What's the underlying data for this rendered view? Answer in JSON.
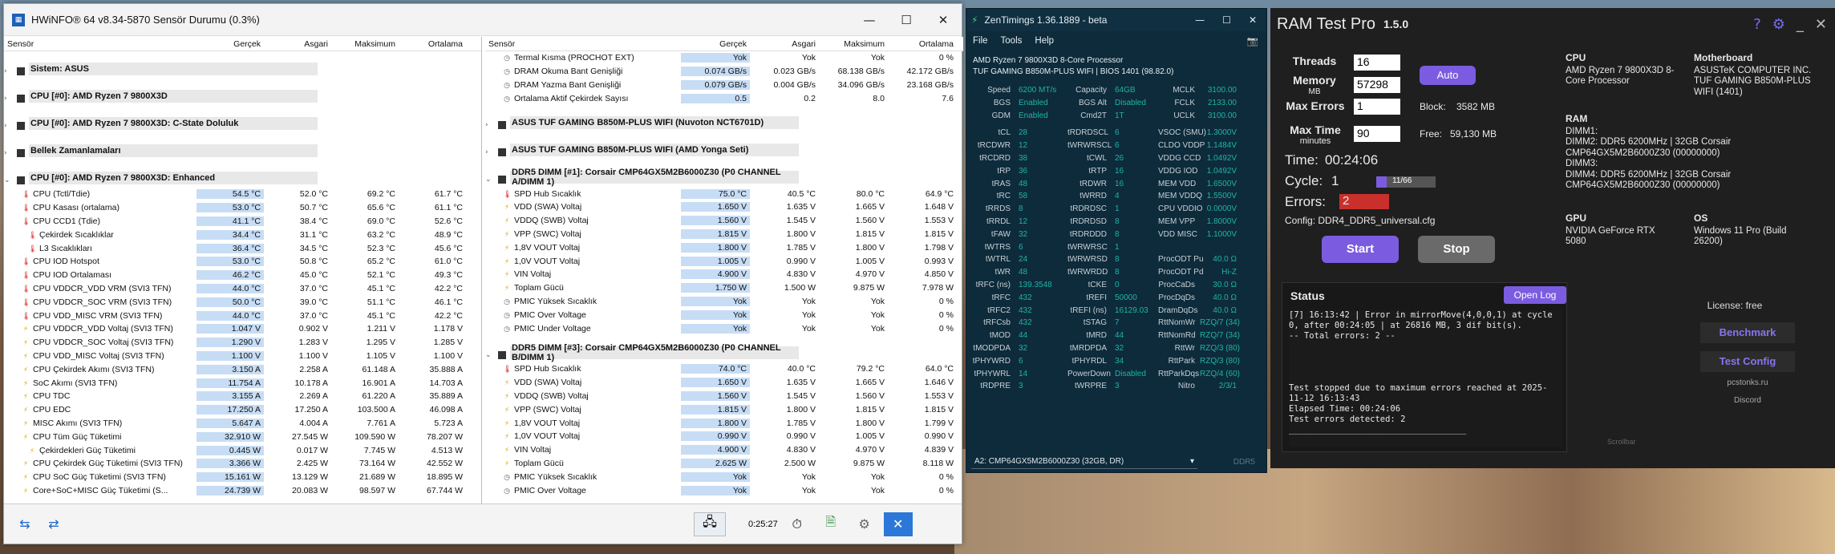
{
  "hw": {
    "title": "HWiNFO® 64 v8.34-5870 Sensör Durumu (0.3%)",
    "headers": [
      "Sensör",
      "Gerçek",
      "Asgari",
      "Maksimum",
      "Ortalama"
    ],
    "left": [
      {
        "g": "Sistem: ASUS",
        "open": false
      },
      {
        "g": "CPU [#0]: AMD Ryzen 7 9800X3D",
        "open": false
      },
      {
        "g": "CPU [#0]: AMD Ryzen 7 9800X3D: C-State Doluluk",
        "open": false
      },
      {
        "g": "Bellek Zamanlamaları",
        "open": false
      },
      {
        "g": "CPU [#0]: AMD Ryzen 7 9800X3D: Enhanced",
        "open": true
      },
      {
        "i": "t",
        "n": "CPU (Tctl/Tdie)",
        "v": [
          "54.5 °C",
          "52.0 °C",
          "69.2 °C",
          "61.7 °C"
        ]
      },
      {
        "i": "t",
        "n": "CPU Kasası (ortalama)",
        "v": [
          "53.0 °C",
          "50.7 °C",
          "65.6 °C",
          "61.1 °C"
        ]
      },
      {
        "i": "t",
        "n": "CPU CCD1 (Tdie)",
        "v": [
          "41.1 °C",
          "38.4 °C",
          "69.0 °C",
          "52.6 °C"
        ]
      },
      {
        "i": "t",
        "n": "Çekirdek Sıcaklıklar",
        "v": [
          "34.4 °C",
          "31.1 °C",
          "63.2 °C",
          "48.9 °C"
        ],
        "sub": true
      },
      {
        "i": "t",
        "n": "L3 Sıcaklıkları",
        "v": [
          "36.4 °C",
          "34.5 °C",
          "52.3 °C",
          "45.6 °C"
        ],
        "sub": true
      },
      {
        "i": "t",
        "n": "CPU IOD Hotspot",
        "v": [
          "53.0 °C",
          "50.8 °C",
          "65.2 °C",
          "61.0 °C"
        ]
      },
      {
        "i": "t",
        "n": "CPU IOD Ortalaması",
        "v": [
          "46.2 °C",
          "45.0 °C",
          "52.1 °C",
          "49.3 °C"
        ]
      },
      {
        "i": "t",
        "n": "CPU VDDCR_VDD VRM (SVI3 TFN)",
        "v": [
          "44.0 °C",
          "37.0 °C",
          "45.1 °C",
          "42.2 °C"
        ]
      },
      {
        "i": "t",
        "n": "CPU VDDCR_SOC VRM (SVI3 TFN)",
        "v": [
          "50.0 °C",
          "39.0 °C",
          "51.1 °C",
          "46.1 °C"
        ]
      },
      {
        "i": "t",
        "n": "CPU VDD_MISC VRM (SVI3 TFN)",
        "v": [
          "44.0 °C",
          "37.0 °C",
          "45.1 °C",
          "42.2 °C"
        ]
      },
      {
        "i": "v",
        "n": "CPU VDDCR_VDD Voltaj (SVI3 TFN)",
        "v": [
          "1.047 V",
          "0.902 V",
          "1.211 V",
          "1.178 V"
        ]
      },
      {
        "i": "v",
        "n": "CPU VDDCR_SOC Voltaj (SVI3 TFN)",
        "v": [
          "1.290 V",
          "1.283 V",
          "1.295 V",
          "1.285 V"
        ]
      },
      {
        "i": "v",
        "n": "CPU VDD_MISC Voltaj (SVI3 TFN)",
        "v": [
          "1.100 V",
          "1.100 V",
          "1.105 V",
          "1.100 V"
        ]
      },
      {
        "i": "v",
        "n": "CPU Çekirdek Akımı (SVI3 TFN)",
        "v": [
          "3.150 A",
          "2.258 A",
          "61.148 A",
          "35.888 A"
        ]
      },
      {
        "i": "v",
        "n": "SoC Akımı (SVI3 TFN)",
        "v": [
          "11.754 A",
          "10.178 A",
          "16.901 A",
          "14.703 A"
        ]
      },
      {
        "i": "v",
        "n": "CPU TDC",
        "v": [
          "3.155 A",
          "2.269 A",
          "61.220 A",
          "35.889 A"
        ]
      },
      {
        "i": "v",
        "n": "CPU EDC",
        "v": [
          "17.250 A",
          "17.250 A",
          "103.500 A",
          "46.098 A"
        ]
      },
      {
        "i": "v",
        "n": "MISC Akımı (SVI3 TFN)",
        "v": [
          "5.647 A",
          "4.004 A",
          "7.761 A",
          "5.723 A"
        ]
      },
      {
        "i": "p",
        "n": "CPU Tüm Güç Tüketimi",
        "v": [
          "32.910 W",
          "27.545 W",
          "109.590 W",
          "78.207 W"
        ]
      },
      {
        "i": "p",
        "n": "Çekirdekleri Güç Tüketimi",
        "v": [
          "0.445 W",
          "0.017 W",
          "7.745 W",
          "4.513 W"
        ],
        "sub": true
      },
      {
        "i": "p",
        "n": "CPU Çekirdek Güç Tüketimi (SVI3 TFN)",
        "v": [
          "3.366 W",
          "2.425 W",
          "73.164 W",
          "42.552 W"
        ]
      },
      {
        "i": "p",
        "n": "CPU SoC Güç Tüketimi (SVI3 TFN)",
        "v": [
          "15.161 W",
          "13.129 W",
          "21.689 W",
          "18.895 W"
        ]
      },
      {
        "i": "p",
        "n": "Core+SoC+MISC Güç Tüketimi (S...",
        "v": [
          "24.739 W",
          "20.083 W",
          "98.597 W",
          "67.744 W"
        ]
      }
    ],
    "right": [
      {
        "i": "o",
        "n": "Termal Kısma (PROCHOT EXT)",
        "v": [
          "Yok",
          "Yok",
          "Yok",
          "0 %"
        ]
      },
      {
        "i": "o",
        "n": "DRAM Okuma Bant Genişliği",
        "v": [
          "0.074 GB/s",
          "0.023 GB/s",
          "68.138 GB/s",
          "42.172 GB/s"
        ]
      },
      {
        "i": "o",
        "n": "DRAM Yazma Bant Genişliği",
        "v": [
          "0.079 GB/s",
          "0.004 GB/s",
          "34.096 GB/s",
          "23.168 GB/s"
        ]
      },
      {
        "i": "o",
        "n": "Ortalama Aktif Çekirdek Sayısı",
        "v": [
          "0.5",
          "0.2",
          "8.0",
          "7.6"
        ]
      },
      {
        "g": "ASUS TUF GAMING B850M-PLUS WIFI (Nuvoton NCT6701D)",
        "open": false
      },
      {
        "g": "ASUS TUF GAMING B850M-PLUS WIFI (AMD Yonga Seti)",
        "open": false
      },
      {
        "g": "DDR5 DIMM [#1]: Corsair CMP64GX5M2B6000Z30 (P0 CHANNEL A/DIMM 1)",
        "open": true
      },
      {
        "i": "t",
        "n": "SPD Hub Sıcaklık",
        "v": [
          "75.0 °C",
          "40.5 °C",
          "80.0 °C",
          "64.9 °C"
        ]
      },
      {
        "i": "v",
        "n": "VDD (SWA) Voltaj",
        "v": [
          "1.650 V",
          "1.635 V",
          "1.665 V",
          "1.648 V"
        ]
      },
      {
        "i": "v",
        "n": "VDDQ (SWB) Voltaj",
        "v": [
          "1.560 V",
          "1.545 V",
          "1.560 V",
          "1.553 V"
        ]
      },
      {
        "i": "v",
        "n": "VPP (SWC) Voltaj",
        "v": [
          "1.815 V",
          "1.800 V",
          "1.815 V",
          "1.815 V"
        ]
      },
      {
        "i": "v",
        "n": "1,8V VOUT Voltaj",
        "v": [
          "1.800 V",
          "1.785 V",
          "1.800 V",
          "1.798 V"
        ]
      },
      {
        "i": "v",
        "n": "1,0V VOUT Voltaj",
        "v": [
          "1.005 V",
          "0.990 V",
          "1.005 V",
          "0.993 V"
        ]
      },
      {
        "i": "v",
        "n": "VIN Voltaj",
        "v": [
          "4.900 V",
          "4.830 V",
          "4.970 V",
          "4.850 V"
        ]
      },
      {
        "i": "p",
        "n": "Toplam Gücü",
        "v": [
          "1.750 W",
          "1.500 W",
          "9.875 W",
          "7.978 W"
        ]
      },
      {
        "i": "o",
        "n": "PMIC Yüksek Sıcaklık",
        "v": [
          "Yok",
          "Yok",
          "Yok",
          "0 %"
        ]
      },
      {
        "i": "o",
        "n": "PMIC Over Voltage",
        "v": [
          "Yok",
          "Yok",
          "Yok",
          "0 %"
        ]
      },
      {
        "i": "o",
        "n": "PMIC Under Voltage",
        "v": [
          "Yok",
          "Yok",
          "Yok",
          "0 %"
        ]
      },
      {
        "g": "DDR5 DIMM [#3]: Corsair CMP64GX5M2B6000Z30 (P0 CHANNEL B/DIMM 1)",
        "open": true
      },
      {
        "i": "t",
        "n": "SPD Hub Sıcaklık",
        "v": [
          "74.0 °C",
          "40.0 °C",
          "79.2 °C",
          "64.0 °C"
        ]
      },
      {
        "i": "v",
        "n": "VDD (SWA) Voltaj",
        "v": [
          "1.650 V",
          "1.635 V",
          "1.665 V",
          "1.646 V"
        ]
      },
      {
        "i": "v",
        "n": "VDDQ (SWB) Voltaj",
        "v": [
          "1.560 V",
          "1.545 V",
          "1.560 V",
          "1.553 V"
        ]
      },
      {
        "i": "v",
        "n": "VPP (SWC) Voltaj",
        "v": [
          "1.815 V",
          "1.800 V",
          "1.815 V",
          "1.815 V"
        ]
      },
      {
        "i": "v",
        "n": "1,8V VOUT Voltaj",
        "v": [
          "1.800 V",
          "1.785 V",
          "1.800 V",
          "1.799 V"
        ]
      },
      {
        "i": "v",
        "n": "1,0V VOUT Voltaj",
        "v": [
          "0.990 V",
          "0.990 V",
          "1.005 V",
          "0.990 V"
        ]
      },
      {
        "i": "v",
        "n": "VIN Voltaj",
        "v": [
          "4.900 V",
          "4.830 V",
          "4.970 V",
          "4.839 V"
        ]
      },
      {
        "i": "p",
        "n": "Toplam Gücü",
        "v": [
          "2.625 W",
          "2.500 W",
          "9.875 W",
          "8.118 W"
        ]
      },
      {
        "i": "o",
        "n": "PMIC Yüksek Sıcaklık",
        "v": [
          "Yok",
          "Yok",
          "Yok",
          "0 %"
        ]
      },
      {
        "i": "o",
        "n": "PMIC Over Voltage",
        "v": [
          "Yok",
          "Yok",
          "Yok",
          "0 %"
        ]
      }
    ],
    "timer": "0:25:27"
  },
  "zen": {
    "title": "ZenTimings 1.36.1889 - beta",
    "menu": [
      "File",
      "Tools",
      "Help"
    ],
    "cpu": "AMD Ryzen 7 9800X3D 8-Core Processor",
    "board": "TUF GAMING B850M-PLUS WIFI | BIOS 1401 (98.82.0)",
    "top": [
      [
        "Speed",
        "6200 MT/s",
        "Capacity",
        "64GB",
        "MCLK",
        "3100.00"
      ],
      [
        "BGS",
        "Enabled",
        "BGS Alt",
        "Disabled",
        "FCLK",
        "2133.00"
      ],
      [
        "GDM",
        "Enabled",
        "Cmd2T",
        "1T",
        "UCLK",
        "3100.00"
      ]
    ],
    "rows": [
      [
        "tCL",
        "28",
        "tRDRDSCL",
        "6",
        "VSOC (SMU)",
        "1.3000V"
      ],
      [
        "tRCDWR",
        "12",
        "tWRWRSCL",
        "6",
        "CLDO VDDP",
        "1.1484V"
      ],
      [
        "tRCDRD",
        "38",
        "tCWL",
        "26",
        "VDDG CCD",
        "1.0492V"
      ],
      [
        "tRP",
        "36",
        "tRTP",
        "16",
        "VDDG IOD",
        "1.0492V"
      ],
      [
        "tRAS",
        "48",
        "tRDWR",
        "16",
        "MEM VDD",
        "1.6500V"
      ],
      [
        "tRC",
        "58",
        "tWRRD",
        "4",
        "MEM VDDQ",
        "1.5500V"
      ],
      [
        "tRRDS",
        "8",
        "tRDRDSC",
        "1",
        "CPU VDDIO",
        "0.0000V"
      ],
      [
        "tRRDL",
        "12",
        "tRDRDSD",
        "8",
        "MEM VPP",
        "1.8000V"
      ],
      [
        "tFAW",
        "32",
        "tRDRDDD",
        "8",
        "VDD MISC",
        "1.1000V"
      ],
      [
        "tWTRS",
        "6",
        "tWRWRSC",
        "1",
        "",
        ""
      ],
      [
        "tWTRL",
        "24",
        "tWRWRSD",
        "8",
        "ProcODT Pu",
        "40.0 Ω"
      ],
      [
        "tWR",
        "48",
        "tWRWRDD",
        "8",
        "ProcODT Pd",
        "Hi-Z"
      ],
      [
        "tRFC (ns)",
        "139.3548",
        "tCKE",
        "0",
        "ProcCaDs",
        "30.0 Ω"
      ],
      [
        "tRFC",
        "432",
        "tREFI",
        "50000",
        "ProcDqDs",
        "40.0 Ω"
      ],
      [
        "tRFC2",
        "432",
        "tREFI (ns)",
        "16129.03",
        "DramDqDs",
        "40.0 Ω"
      ],
      [
        "tRFCsb",
        "432",
        "tSTAG",
        "7",
        "RttNomWr",
        "RZQ/7 (34)"
      ],
      [
        "tMOD",
        "44",
        "tMRD",
        "44",
        "RttNomRd",
        "RZQ/7 (34)"
      ],
      [
        "tMODPDA",
        "32",
        "tMRDPDA",
        "32",
        "RttWr",
        "RZQ/3 (80)"
      ],
      [
        "tPHYWRD",
        "6",
        "tPHYRDL",
        "34",
        "RttPark",
        "RZQ/3 (80)"
      ],
      [
        "tPHYWRL",
        "14",
        "PowerDown",
        "Disabled",
        "RttParkDqs",
        "RZQ/4 (60)"
      ],
      [
        "tRDPRE",
        "3",
        "tWRPRE",
        "3",
        "Nitro",
        "2/3/1"
      ]
    ],
    "dimm": "A2: CMP64GX5M2B6000Z30 (32GB, DR)",
    "ddr": "DDR5"
  },
  "rtp": {
    "title": "RAM Test Pro",
    "version": "1.5.0",
    "threads_label": "Threads",
    "threads": "16",
    "memory_label": "Memory",
    "memory_unit": "MB",
    "memory": "57298",
    "auto": "Auto",
    "maxerr_label": "Max Errors",
    "maxerr": "1",
    "maxtime_label": "Max Time",
    "maxtime_unit": "minutes",
    "maxtime": "90",
    "block_label": "Block:",
    "block": "3582 MB",
    "free_label": "Free:",
    "free": "59,130 MB",
    "time_label": "Time:",
    "time": "00:24:06",
    "cycle_label": "Cycle:",
    "cycle": "1",
    "cycle_prog": "11/66",
    "cycle_frac": 0.17,
    "errors_label": "Errors:",
    "errors": "2",
    "config": "Config: DDR4_DDR5_universal.cfg",
    "start": "Start",
    "stop": "Stop",
    "cpu_h": "CPU",
    "cpu": "AMD Ryzen 7 9800X3D 8-Core Processor",
    "mb_h": "Motherboard",
    "mb": "ASUSTeK COMPUTER INC. TUF GAMING B850M-PLUS WIFI (1401)",
    "ram_h": "RAM",
    "ram": "DIMM1:\nDIMM2: DDR5 6200MHz | 32GB Corsair CMP64GX5M2B6000Z30 (00000000)\nDIMM3:\nDIMM4: DDR5 6200MHz | 32GB Corsair CMP64GX5M2B6000Z30 (00000000)",
    "gpu_h": "GPU",
    "gpu": "NVIDIA GeForce RTX 5080",
    "os_h": "OS",
    "os": "Windows 11 Pro (Build 26200)",
    "status_h": "Status",
    "openlog": "Open Log",
    "log": "[7] 16:13:42 | Error in mirrorMove(4,0,0,1) at cycle 0, after 00:24:05 | at 26816 MB, 3 dif bit(s).\n-- Total errors: 2 --\n\n\n\n\nTest stopped due to maximum errors reached at 2025-11-12 16:13:43\nElapsed Time: 00:24:06\nTest errors detected: 2\n___________________________________",
    "license": "License: free",
    "bench": "Benchmark",
    "tconfig": "Test Config",
    "site": "pcstonks.ru",
    "discord": "Discord",
    "scroll": "Scrollbar"
  }
}
